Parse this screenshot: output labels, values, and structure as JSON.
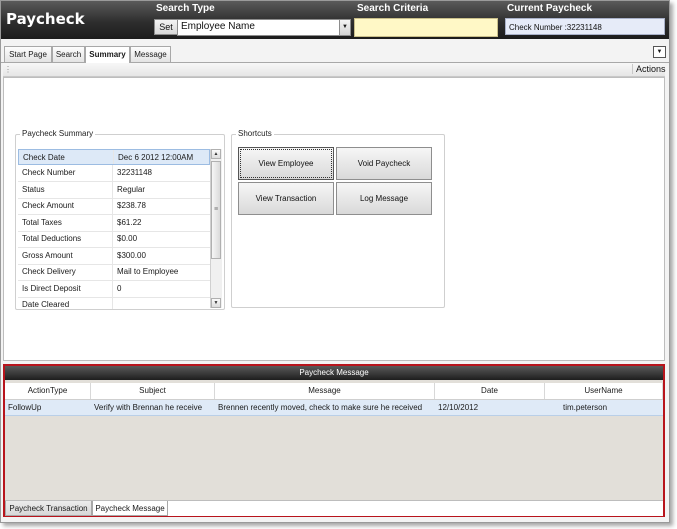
{
  "app": {
    "title": "Paycheck"
  },
  "header": {
    "search_type_label": "Search Type",
    "set_label": "Set",
    "search_type_value": "Employee Name",
    "search_criteria_label": "Search Criteria",
    "search_criteria_value": "",
    "current_paycheck_label": "Current Paycheck",
    "current_paycheck_value": "Check Number :32231148"
  },
  "tabs": [
    {
      "label": "Start Page",
      "active": false
    },
    {
      "label": "Search",
      "active": false
    },
    {
      "label": "Summary",
      "active": true
    },
    {
      "label": "Message",
      "active": false
    }
  ],
  "toolbar": {
    "actions_label": "Actions"
  },
  "summary": {
    "title": "Paycheck Summary",
    "rows": [
      {
        "key": "Check Date",
        "value": "Dec  6 2012 12:00AM",
        "selected": true
      },
      {
        "key": "Check Number",
        "value": "32231148"
      },
      {
        "key": "Status",
        "value": "Regular"
      },
      {
        "key": "Check Amount",
        "value": "$238.78"
      },
      {
        "key": "Total Taxes",
        "value": "$61.22"
      },
      {
        "key": "Total Deductions",
        "value": "$0.00"
      },
      {
        "key": "Gross Amount",
        "value": "$300.00"
      },
      {
        "key": "Check Delivery",
        "value": "Mail to Employee"
      },
      {
        "key": "Is Direct Deposit",
        "value": "0"
      },
      {
        "key": "Date Cleared",
        "value": ""
      }
    ]
  },
  "shortcuts": {
    "title": "Shortcuts",
    "buttons": [
      "View Employee",
      "Void Paycheck",
      "View Transaction",
      "Log Message"
    ]
  },
  "messages": {
    "title": "Paycheck Message",
    "columns": [
      "ActionType",
      "Subject",
      "Message",
      "Date",
      "UserName"
    ],
    "rows": [
      [
        "FollowUp",
        "Verify with Brennan he receive",
        "Brennen recently moved, check to make sure he received",
        "12/10/2012",
        "tim.peterson"
      ]
    ]
  },
  "bottom_tabs": [
    {
      "label": "Paycheck Transaction",
      "active": false
    },
    {
      "label": "Paycheck Message",
      "active": true
    }
  ],
  "colors": {
    "header_dark": "#2e2e2e",
    "criteria_bg": "#fff8c6",
    "highlight_red": "#b8141c",
    "selection_blue": "#dde9f7"
  }
}
